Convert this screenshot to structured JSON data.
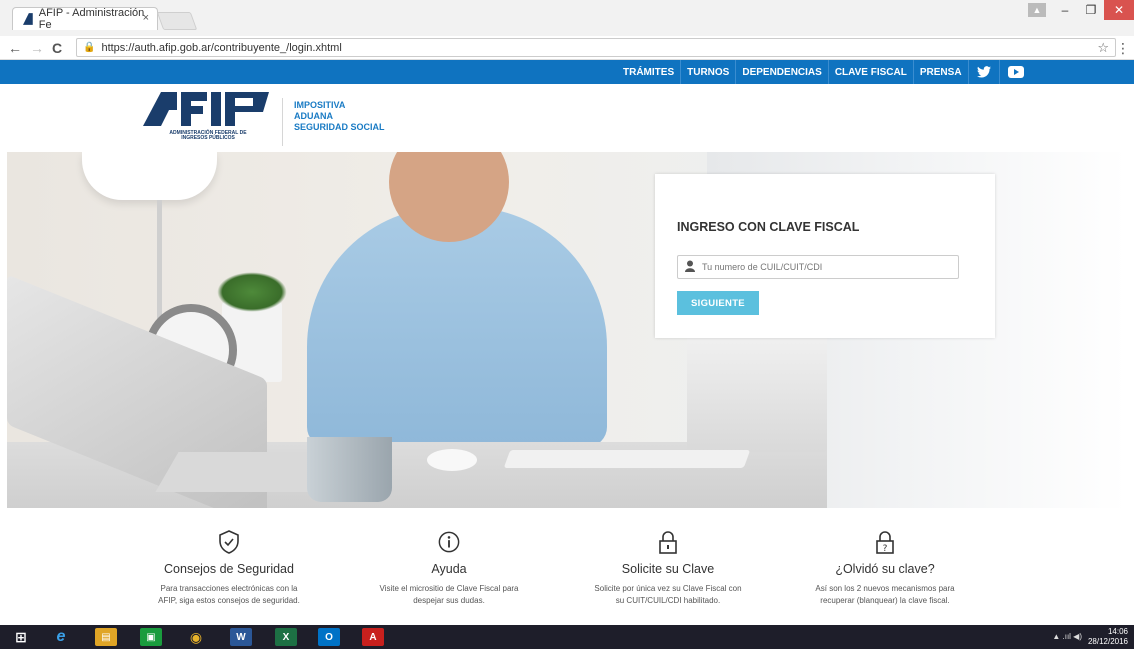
{
  "browser": {
    "tab_title": "AFIP - Administración Fe",
    "tab_close": "×",
    "url": "https://auth.afip.gob.ar/contribuyente_/login.xhtml",
    "back": "←",
    "forward": "→",
    "reload": "C",
    "star": "☆",
    "menu": "⋮",
    "win_user": "▲",
    "win_minimize": "–",
    "win_restore": "❐",
    "win_close": "✕"
  },
  "topnav": {
    "items": [
      "TRÁMITES",
      "TURNOS",
      "DEPENDENCIAS",
      "CLAVE FISCAL",
      "PRENSA"
    ],
    "twitter": "twitter-icon",
    "youtube": "youtube-icon",
    "twitter_glyph": "🐦",
    "youtube_glyph": "▶"
  },
  "header": {
    "logo_text": "AFIP",
    "logo_sub_1": "ADMINISTRACIÓN FEDERAL DE",
    "logo_sub_2": "INGRESOS PÚBLICOS",
    "tagline": [
      "IMPOSITIVA",
      "ADUANA",
      "SEGURIDAD SOCIAL"
    ]
  },
  "login": {
    "title": "INGRESO CON CLAVE FISCAL",
    "placeholder": "Tu numero de CUIL/CUIT/CDI",
    "button": "SIGUIENTE"
  },
  "features": [
    {
      "icon": "shield-check-icon",
      "title": "Consejos de Seguridad",
      "desc_1": "Para transacciones electrónicas con la",
      "desc_2": "AFIP, siga estos consejos de seguridad."
    },
    {
      "icon": "info-icon",
      "title": "Ayuda",
      "desc_1": "Visite el micrositio de Clave Fiscal para",
      "desc_2": "despejar sus dudas."
    },
    {
      "icon": "lock-icon",
      "title": "Solicite su Clave",
      "desc_1": "Solicite por única vez su Clave Fiscal con",
      "desc_2": "su CUIT/CUIL/CDI habilitado."
    },
    {
      "icon": "lock-question-icon",
      "title": "¿Olvidó su clave?",
      "desc_1": "Así son los 2 nuevos mecanismos para",
      "desc_2": "recuperar (blanquear) la clave fiscal."
    }
  ],
  "taskbar": {
    "time": "14:06",
    "date": "28/12/2016",
    "tray": "▲  .ııl  ◀)",
    "apps": [
      {
        "name": "start",
        "label": "⊞",
        "color": "#1e1e2a"
      },
      {
        "name": "ie",
        "label": "e",
        "color": "#1e1e2a"
      },
      {
        "name": "explorer",
        "label": "▤",
        "color": "#e0a526"
      },
      {
        "name": "store",
        "label": "▣",
        "color": "#1a9c3e"
      },
      {
        "name": "chrome",
        "label": "◉",
        "color": "#1e1e2a"
      },
      {
        "name": "word",
        "label": "W",
        "color": "#2b5797"
      },
      {
        "name": "excel",
        "label": "X",
        "color": "#1d7044"
      },
      {
        "name": "outlook",
        "label": "O",
        "color": "#0072c6"
      },
      {
        "name": "acrobat",
        "label": "A",
        "color": "#c8201d"
      }
    ]
  },
  "colors": {
    "nav_blue": "#0f73c0",
    "accent_blue": "#1a7bc4",
    "button": "#5bc0de"
  }
}
